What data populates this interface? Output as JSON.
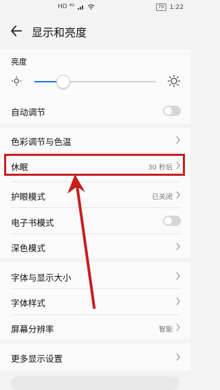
{
  "status_bar": {
    "left_icons": "HD ⁴ᴳ",
    "battery": "70",
    "time": "1:22"
  },
  "header": {
    "title": "显示和亮度"
  },
  "brightness": {
    "section_label": "亮度",
    "level_percent": 23
  },
  "items": {
    "auto_adjust": {
      "label": "自动调节",
      "toggle_on": false
    },
    "color": {
      "label": "色彩调节与色温"
    },
    "sleep": {
      "label": "休眠",
      "value": "30 秒后"
    },
    "eye_care": {
      "label": "护眼模式",
      "value": "已关闭"
    },
    "ebook": {
      "label": "电子书模式",
      "toggle_on": false
    },
    "dark": {
      "label": "深色模式"
    },
    "font_size": {
      "label": "字体与显示大小"
    },
    "font_style": {
      "label": "字体样式"
    },
    "resolution": {
      "label": "屏幕分辨率",
      "value": "智能"
    },
    "more": {
      "label": "更多显示设置"
    }
  },
  "annotation": {
    "box_color": "#c81e1e",
    "arrow_color": "#c81e1e"
  }
}
